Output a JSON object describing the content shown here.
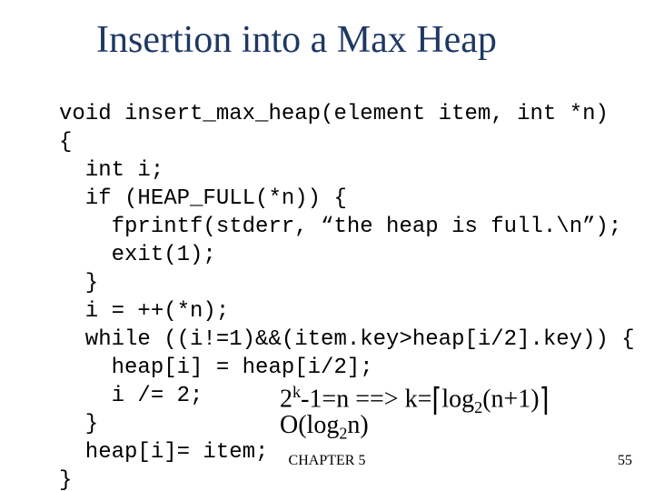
{
  "title": "Insertion into a Max Heap",
  "code": {
    "l1": "void insert_max_heap(element item, int *n)",
    "l2": "{",
    "l3": "  int i;",
    "l4": "  if (HEAP_FULL(*n)) {",
    "l5": "    fprintf(stderr, “the heap is full.\\n”);",
    "l6": "    exit(1);",
    "l7": "  }",
    "l8": "  i = ++(*n);",
    "l9": "  while ((i!=1)&&(item.key>heap[i/2].key)) {",
    "l10": "    heap[i] = heap[i/2];",
    "l11": "    i /= 2;",
    "l12": "  }",
    "l13": "  heap[i]= item;",
    "l14": "}"
  },
  "annotation1": {
    "base_2k": "2",
    "exp_k": "k",
    "middle": "-1=n ==> k=",
    "ceil_l": "⌈",
    "log_txt": "log",
    "sub2": "2",
    "arg": "(n+1)",
    "ceil_r": "⌉"
  },
  "annotation2": {
    "prefix_O": "O(log",
    "sub2": "2",
    "suffix": "n)"
  },
  "footer": {
    "center": "CHAPTER 5",
    "page": "55"
  }
}
